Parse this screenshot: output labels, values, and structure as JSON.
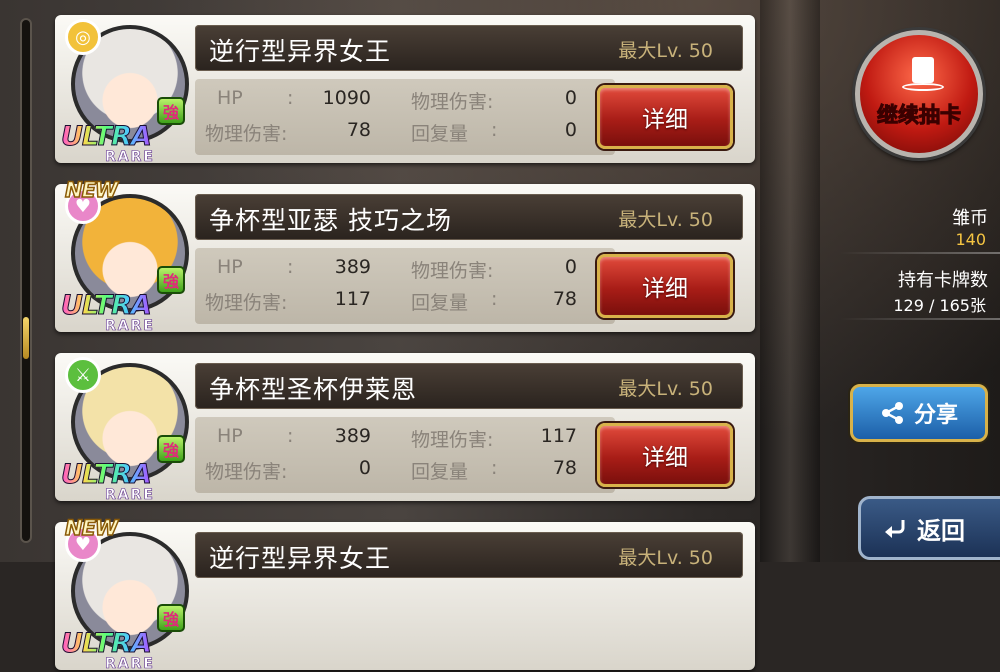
{
  "cards": [
    {
      "name": "逆行型异界女王",
      "max_level": "最大Lv. 50",
      "hp_label": "HP",
      "hp_value": "1090",
      "phys_dmg_label_1": "物理伤害:",
      "phys_dmg_value_1": "0",
      "phys_dmg_label_2": "物理伤害:",
      "phys_dmg_value_2": "78",
      "recover_label": "回复量",
      "recover_value": "0",
      "detail_label": "详细",
      "new": false,
      "attr_color": "#f2c23a",
      "hair_color": "#e9e6e2"
    },
    {
      "name": "争杯型亚瑟 技巧之场",
      "max_level": "最大Lv. 50",
      "hp_label": "HP",
      "hp_value": "389",
      "phys_dmg_label_1": "物理伤害:",
      "phys_dmg_value_1": "0",
      "phys_dmg_label_2": "物理伤害:",
      "phys_dmg_value_2": "117",
      "recover_label": "回复量",
      "recover_value": "78",
      "detail_label": "详细",
      "new": true,
      "attr_color": "#e987c9",
      "hair_color": "#f2b33a"
    },
    {
      "name": "争杯型圣杯伊莱恩",
      "max_level": "最大Lv. 50",
      "hp_label": "HP",
      "hp_value": "389",
      "phys_dmg_label_1": "物理伤害:",
      "phys_dmg_value_1": "117",
      "phys_dmg_label_2": "物理伤害:",
      "phys_dmg_value_2": "0",
      "recover_label": "回复量",
      "recover_value": "78",
      "detail_label": "详细",
      "new": false,
      "attr_color": "#5cbf3e",
      "hair_color": "#f3e2a8"
    },
    {
      "name": "逆行型异界女王",
      "max_level": "最大Lv. 50",
      "new": true,
      "attr_color": "#e987c9",
      "hair_color": "#e9e6e2"
    }
  ],
  "badges": {
    "ultra": "ULTRA",
    "rare": "RARE",
    "new": "NEW",
    "strong": "強"
  },
  "sidebar": {
    "gacha_label": "继续抽卡",
    "coin_label": "雏币",
    "coin_value": "140",
    "cards_label": "持有卡牌数",
    "cards_value": "129 / 165张",
    "share_label": "分享",
    "back_label": "返回"
  },
  "colors": {
    "accent_gold": "#d8b24a",
    "coin_yellow": "#f5c542",
    "button_red": "#b8231c",
    "button_blue": "#1c5fa8"
  },
  "scroll_position": 0.62
}
